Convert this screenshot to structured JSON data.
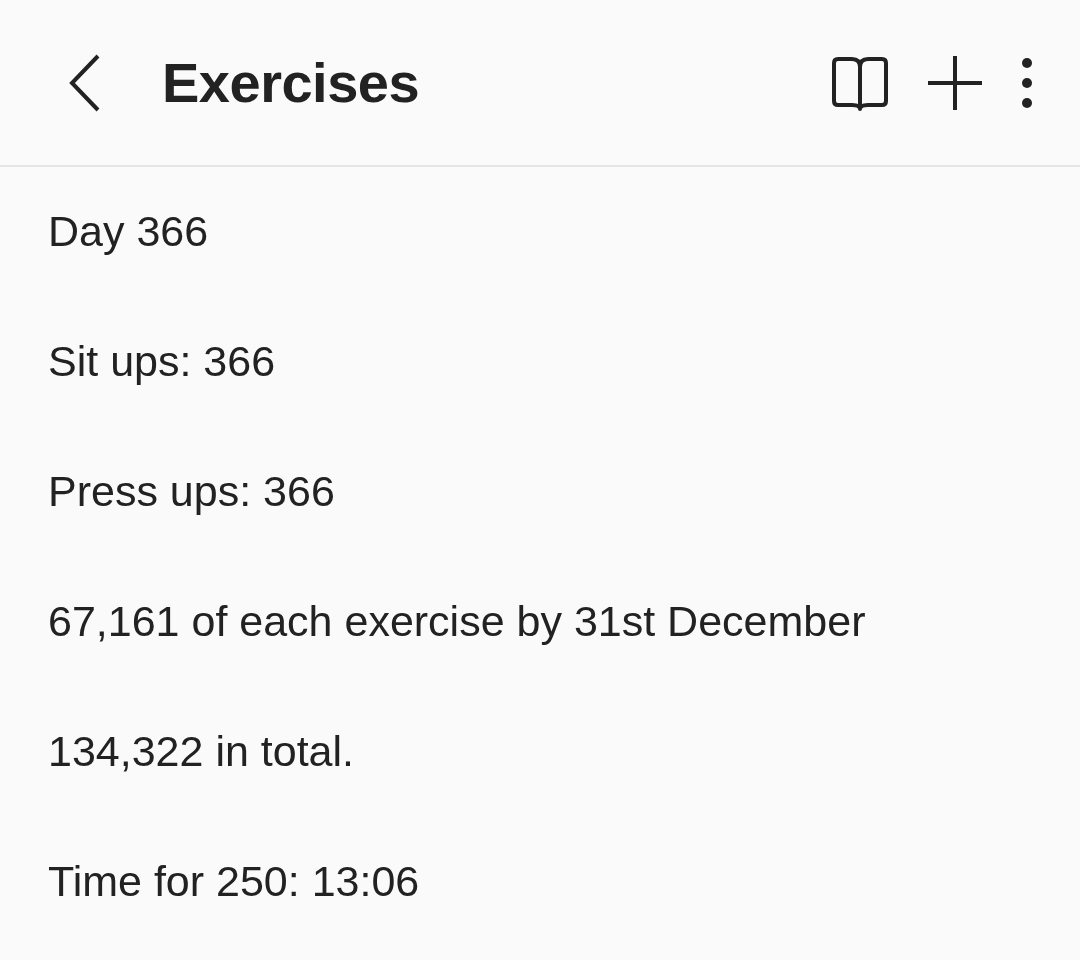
{
  "header": {
    "title": "Exercises"
  },
  "note": {
    "lines": [
      "Day 366",
      "Sit ups: 366",
      "Press ups: 366",
      "67,161 of each exercise by 31st December",
      "134,322 in total.",
      "Time for 250: 13:06"
    ]
  }
}
